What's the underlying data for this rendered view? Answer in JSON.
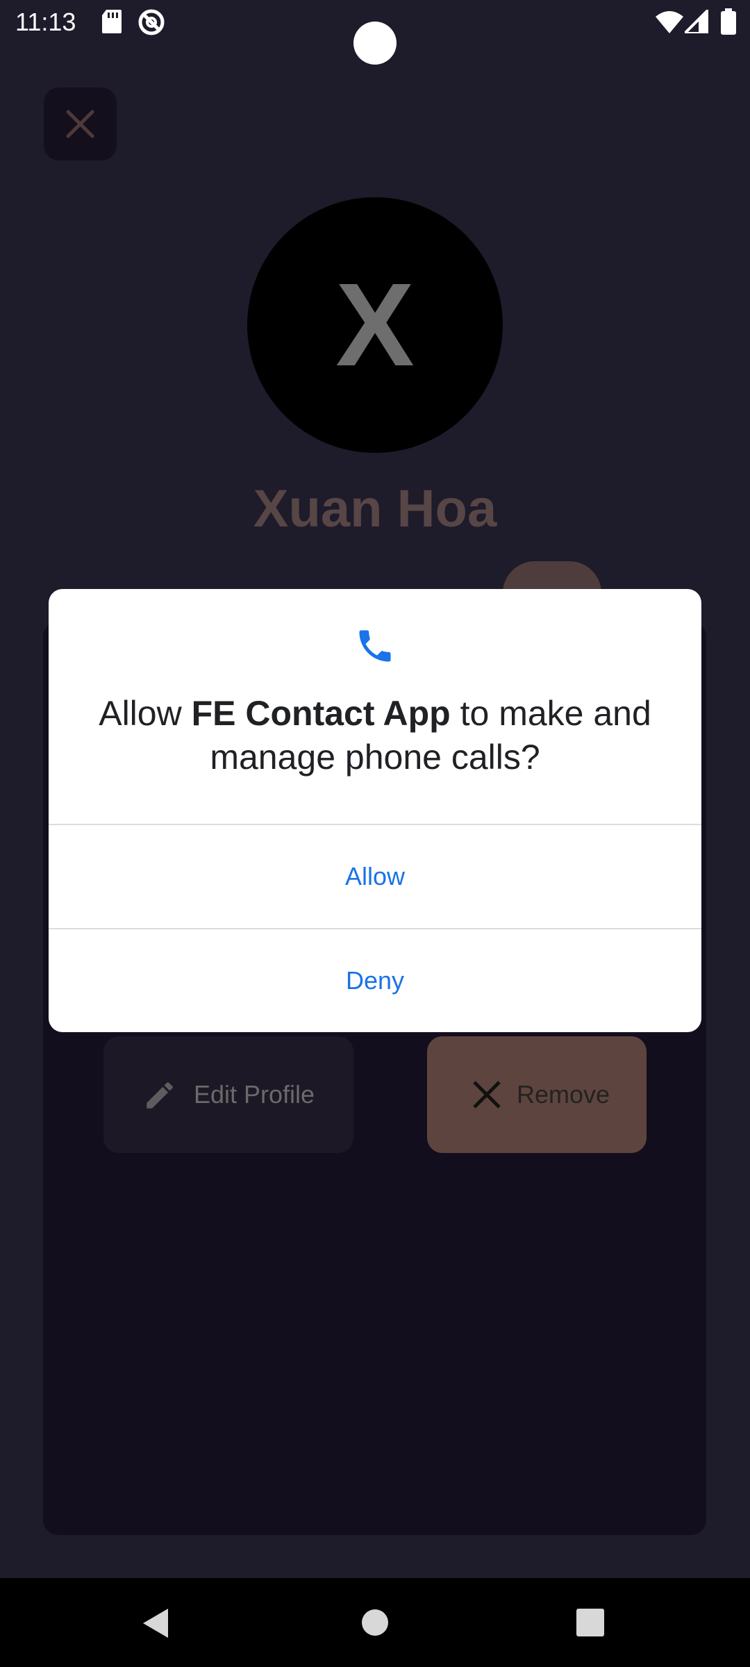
{
  "status_bar": {
    "time": "11:13",
    "icons": [
      "sd-card-icon",
      "do-not-disturb-icon",
      "wifi-icon",
      "signal-icon",
      "battery-icon"
    ]
  },
  "header": {
    "close_icon": "close-icon"
  },
  "profile": {
    "avatar_letter": "X",
    "name": "Xuan Hoa"
  },
  "actions": {
    "edit_label": "Edit Profile",
    "edit_icon": "pencil-icon",
    "remove_label": "Remove",
    "remove_icon": "close-icon"
  },
  "dialog": {
    "icon": "phone-icon",
    "message_prefix": "Allow ",
    "app_name": "FE Contact App",
    "message_suffix": " to make and manage phone calls?",
    "allow_label": "Allow",
    "deny_label": "Deny"
  },
  "nav_bar": {
    "items": [
      "back-icon",
      "home-icon",
      "recents-icon"
    ]
  },
  "colors": {
    "background": "#1e1b2b",
    "card": "#130e1e",
    "dialog_accent": "#1a73e8",
    "remove_button": "#5e443f"
  }
}
